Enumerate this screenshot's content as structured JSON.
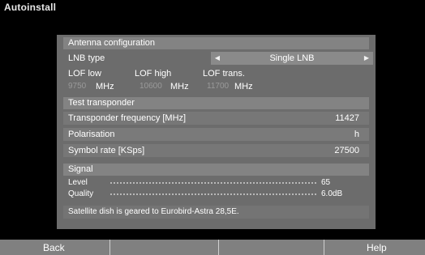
{
  "app": {
    "title": "Autoinstall"
  },
  "antenna": {
    "header": "Antenna configuration",
    "lnb_type_label": "LNB type",
    "lnb_type_value": "Single LNB",
    "lof_low_label": "LOF low",
    "lof_high_label": "LOF high",
    "lof_trans_label": "LOF trans.",
    "lof_low_value": "9750",
    "lof_high_value": "10600",
    "lof_trans_value": "11700",
    "unit": "MHz"
  },
  "transponder": {
    "header": "Test transponder",
    "frequency_label": "Transponder frequency [MHz]",
    "frequency_value": "11427",
    "polarisation_label": "Polarisation",
    "polarisation_value": "h",
    "symbol_rate_label": "Symbol rate [KSps]",
    "symbol_rate_value": "27500"
  },
  "signal": {
    "header": "Signal",
    "level_label": "Level",
    "level_value": "65",
    "quality_label": "Quality",
    "quality_value": "6.0dB"
  },
  "status": {
    "message": "Satellite dish is geared to Eurobird-Astra 28,5E."
  },
  "softkeys": {
    "back": "Back",
    "help": "Help"
  },
  "icons": {
    "left": "arrow-left-icon",
    "right": "arrow-right-icon"
  }
}
